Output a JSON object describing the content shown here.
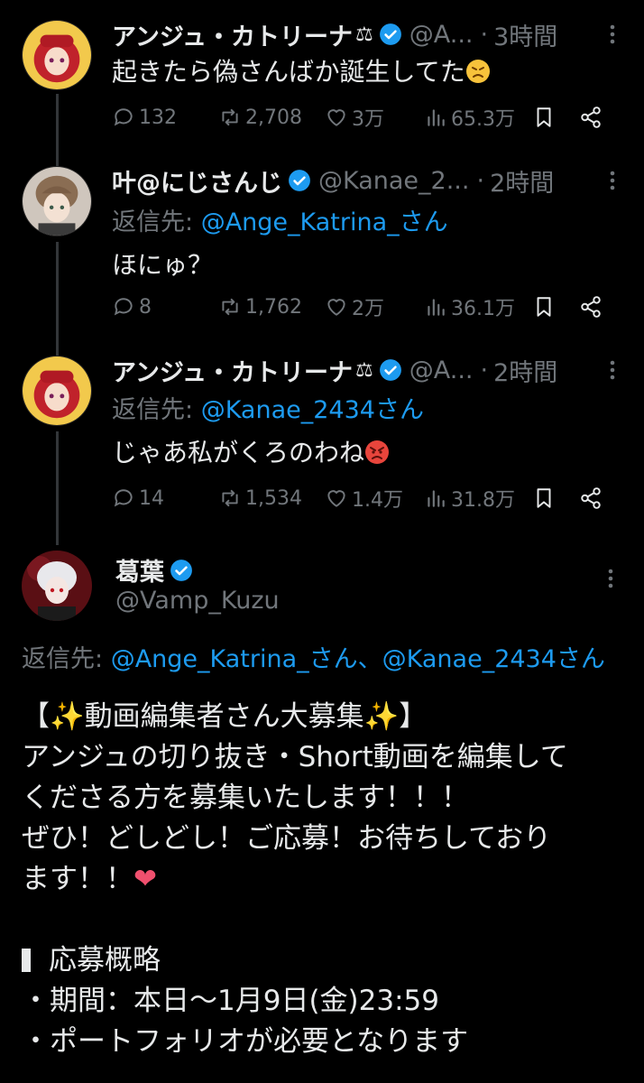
{
  "tweets": [
    {
      "name": "アンジュ・カトリーナ",
      "name_suffix": "⚖",
      "handle": "@A...",
      "time": "3時間",
      "reply_to_prefix": "",
      "reply_to": "",
      "text": "起きたら偽さんばか誕生してた",
      "emoji": "persevering-face",
      "replies": "132",
      "retweets": "2,708",
      "likes": "3万",
      "views": "65.3万"
    },
    {
      "name": "叶@にじさんじ",
      "name_suffix": "",
      "handle": "@Kanae_2...",
      "time": "2時間",
      "reply_to_prefix": "返信先: ",
      "reply_to": "@Ange_Katrina_さん",
      "text": "ほにゅ？",
      "emoji": "",
      "replies": "8",
      "retweets": "1,762",
      "likes": "2万",
      "views": "36.1万"
    },
    {
      "name": "アンジュ・カトリーナ",
      "name_suffix": "⚖",
      "handle": "@A...",
      "time": "2時間",
      "reply_to_prefix": "返信先: ",
      "reply_to": "@Kanae_2434さん",
      "text": "じゃあ私がくろのわね",
      "emoji": "angry-face",
      "replies": "14",
      "retweets": "1,534",
      "likes": "1.4万",
      "views": "31.8万"
    }
  ],
  "main_tweet": {
    "name": "葛葉",
    "handle": "@Vamp_Kuzu",
    "reply_to_prefix": "返信先: ",
    "reply_to_1": "@Ange_Katrina_さん",
    "reply_to_sep": "、",
    "reply_to_2": "@Kanae_2434さん",
    "lines": [
      "【✨動画編集者さん大募集✨】",
      "アンジュの切り抜き・Short動画を編集して",
      "くださる方を募集いたします！！！",
      "ぜひ！どしどし！ご応募！お待ちしており",
      "ます！！",
      "",
      "応募概略",
      "・期間：本日〜1月9日(金)23:59",
      "・ポートフォリオが必要となります"
    ],
    "heart": "❤"
  },
  "colors": {
    "background": "#000000",
    "text": "#e7e9ea",
    "muted": "#71767b",
    "link": "#1d9bf0",
    "verified": "#1d9bf0"
  },
  "dot": "·"
}
